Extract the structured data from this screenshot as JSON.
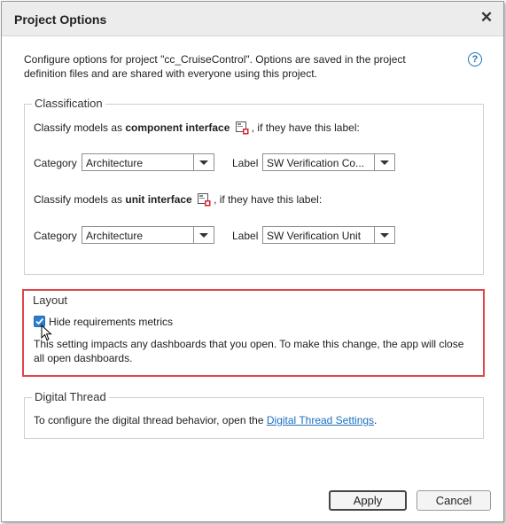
{
  "dialog": {
    "title": "Project Options",
    "intro": "Configure options for project \"cc_CruiseControl\". Options are saved in the project definition files and are shared with everyone using this project."
  },
  "classification": {
    "legend": "Classification",
    "component": {
      "prefix": "Classify models as ",
      "emphasis": "component interface",
      "suffix": ", if they have this label:",
      "category_label": "Category",
      "category_value": "Architecture",
      "label_label": "Label",
      "label_value": "SW Verification Co..."
    },
    "unit": {
      "prefix": "Classify models as ",
      "emphasis": "unit interface",
      "suffix": ", if they have this label:",
      "category_label": "Category",
      "category_value": "Architecture",
      "label_label": "Label",
      "label_value": "SW Verification Unit"
    }
  },
  "layout": {
    "legend": "Layout",
    "checkbox_label": "Hide requirements metrics",
    "checked": true,
    "note": "This setting impacts any dashboards that you open. To make this change, the app will close all open dashboards."
  },
  "digital_thread": {
    "legend": "Digital Thread",
    "text": "To configure the digital thread behavior, open the ",
    "link": "Digital Thread Settings",
    "suffix": "."
  },
  "buttons": {
    "apply": "Apply",
    "cancel": "Cancel"
  },
  "icons": {
    "close": "close-icon",
    "help": "help-icon",
    "interface": "model-interface-icon",
    "dropdown": "chevron-down-icon",
    "check": "checkmark-icon",
    "cursor": "mouse-pointer-icon"
  },
  "colors": {
    "highlight": "#e0454a",
    "link": "#1a6fc0",
    "checkbox": "#2d7cd0"
  }
}
